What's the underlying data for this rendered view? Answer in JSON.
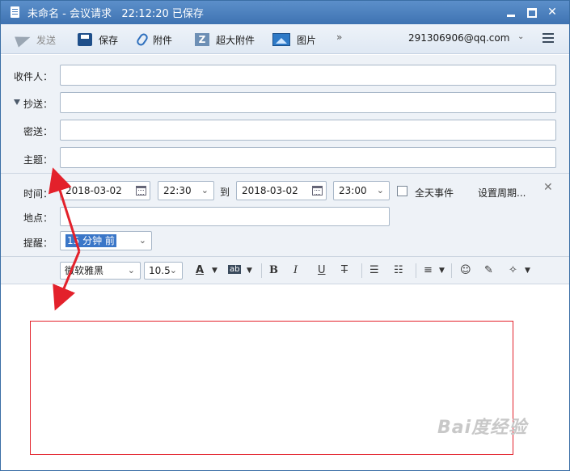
{
  "window": {
    "title": "未命名 - 会议请求",
    "saved_status": "22:12:20 已保存"
  },
  "toolbar": {
    "send_label": "发送",
    "save_label": "保存",
    "attach_label": "附件",
    "big_attach_label": "超大附件",
    "picture_label": "图片",
    "more_label": "»",
    "account": "291306906@qq.com"
  },
  "fields": {
    "to_label": "收件人：",
    "cc_label": "抄送：",
    "bcc_label": "密送：",
    "subject_label": "主题："
  },
  "meeting": {
    "time_label": "时间：",
    "start_date": "2018-03-02",
    "start_time": "22:30",
    "to_label": "到",
    "end_date": "2018-03-02",
    "end_time": "23:00",
    "all_day_label": "全天事件",
    "recurrence_label": "设置周期...",
    "location_label": "地点：",
    "reminder_label": "提醒：",
    "reminder_value": "15 分钟 前"
  },
  "format": {
    "font": "微软雅黑",
    "size": "10.5"
  },
  "watermark": "Bai度经验",
  "colors": {
    "annotation": "#e3212b",
    "titlebar": "#4a7fbd"
  }
}
